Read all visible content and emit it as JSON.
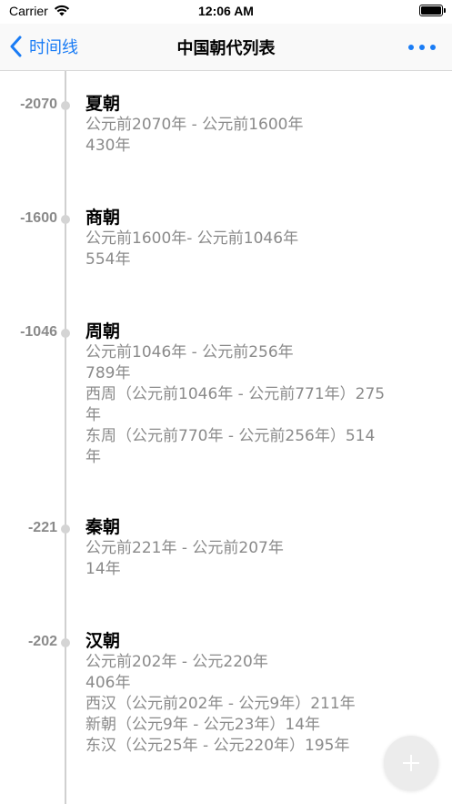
{
  "status_bar": {
    "carrier": "Carrier",
    "time": "12:06 AM"
  },
  "nav": {
    "back_label": "时间线",
    "title": "中国朝代列表"
  },
  "colors": {
    "accent": "#1a7cf5",
    "secondary_text": "#8a8a8a",
    "timeline_line": "#d0d0d0"
  },
  "entries": [
    {
      "year": "-2070",
      "title": "夏朝",
      "lines": [
        "公元前2070年 - 公元前1600年",
        "430年"
      ]
    },
    {
      "year": "-1600",
      "title": "商朝",
      "lines": [
        "公元前1600年- 公元前1046年",
        "554年"
      ]
    },
    {
      "year": "-1046",
      "title": "周朝",
      "lines": [
        "公元前1046年 - 公元前256年",
        "789年",
        "西周（公元前1046年 - 公元前771年）275",
        "年",
        "东周（公元前770年 - 公元前256年）514",
        "年"
      ]
    },
    {
      "year": "-221",
      "title": "秦朝",
      "lines": [
        "公元前221年 - 公元前207年",
        "14年"
      ]
    },
    {
      "year": "-202",
      "title": "汉朝",
      "lines": [
        "公元前202年 - 公元220年",
        "406年",
        "西汉（公元前202年 - 公元9年）211年",
        "新朝（公元9年 - 公元23年）14年",
        "东汉（公元25年 - 公元220年）195年"
      ]
    }
  ]
}
